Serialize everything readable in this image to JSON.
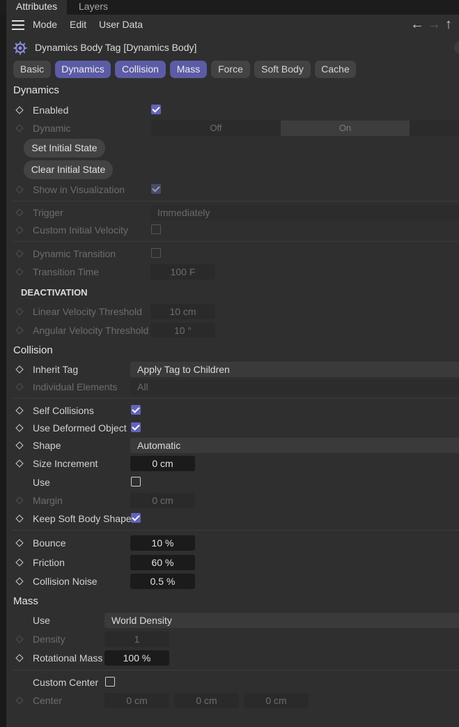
{
  "tabs": [
    "Attributes",
    "Layers"
  ],
  "menu": [
    "Mode",
    "Edit",
    "User Data"
  ],
  "title": "Dynamics Body Tag [Dynamics Body]",
  "page_tabs": [
    "Basic",
    "Dynamics",
    "Collision",
    "Mass",
    "Force",
    "Soft Body",
    "Cache"
  ],
  "dynamics": {
    "heading": "Dynamics",
    "enabled": "Enabled",
    "dynamic": "Dynamic",
    "dynamic_off": "Off",
    "dynamic_on": "On",
    "set_initial": "Set Initial State",
    "clear_initial": "Clear Initial State",
    "show_vis": "Show in Visualization",
    "trigger": "Trigger",
    "trigger_value": "Immediately",
    "custom_velocity": "Custom Initial Velocity",
    "dyn_transition": "Dynamic Transition",
    "transition_time": "Transition Time",
    "transition_time_value": "100 F",
    "deactivation": "DEACTIVATION",
    "linear_thresh": "Linear Velocity Threshold",
    "linear_thresh_value": "10 cm",
    "angular_thresh": "Angular Velocity Threshold",
    "angular_thresh_value": "10 °"
  },
  "collision": {
    "heading": "Collision",
    "inherit_tag": "Inherit Tag",
    "inherit_tag_value": "Apply Tag to Children",
    "individual": "Individual Elements",
    "individual_value": "All",
    "self_collisions": "Self Collisions",
    "use_deformed": "Use Deformed Object",
    "shape": "Shape",
    "shape_value": "Automatic",
    "size_increment": "Size Increment",
    "size_increment_value": "0 cm",
    "use": "Use",
    "margin": "Margin",
    "margin_value": "0 cm",
    "keep_soft": "Keep Soft Body Shape",
    "bounce": "Bounce",
    "bounce_value": "10 %",
    "friction": "Friction",
    "friction_value": "60 %",
    "noise": "Collision Noise",
    "noise_value": "0.5 %"
  },
  "mass": {
    "heading": "Mass",
    "use": "Use",
    "use_value": "World Density",
    "density": "Density",
    "density_value": "1",
    "rot_mass": "Rotational Mass",
    "rot_mass_value": "100 %",
    "custom_center": "Custom Center",
    "center": "Center",
    "center_values": [
      "0 cm",
      "0 cm",
      "0 cm"
    ]
  },
  "colors": {
    "accent": "#5b5ba6",
    "panel": "#2f2f2f",
    "field": "#1b1b1b"
  }
}
